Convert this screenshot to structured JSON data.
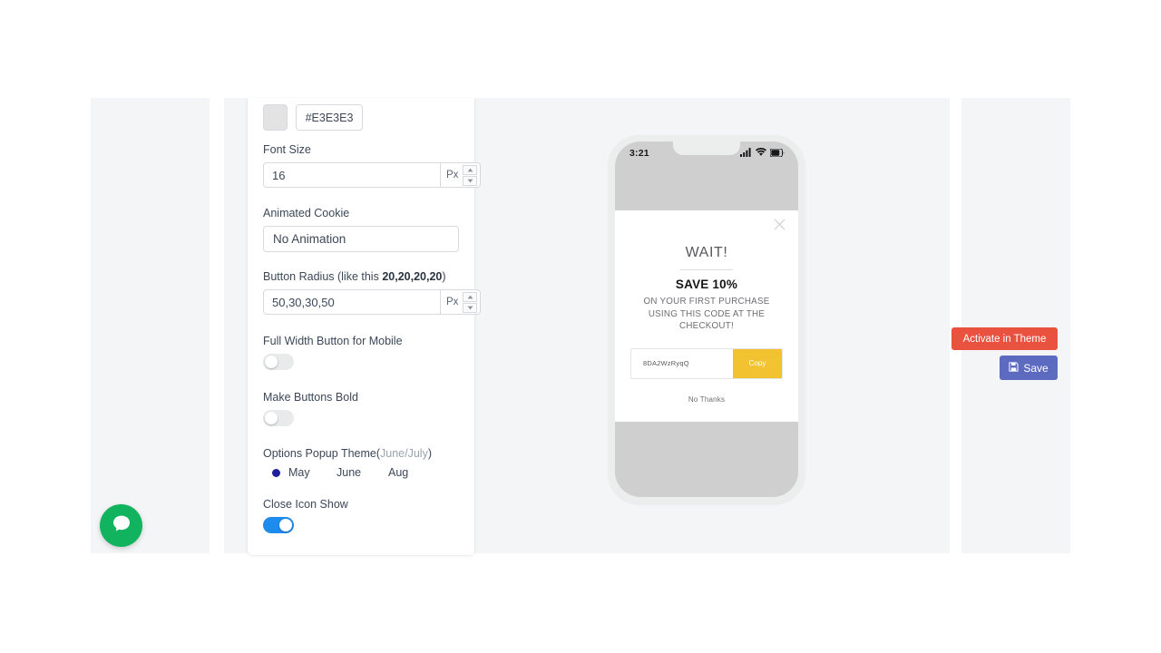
{
  "settings": {
    "color": {
      "swatch_hex": "#E3E3E3",
      "value": "#E3E3E3"
    },
    "font_size": {
      "label": "Font Size",
      "value": "16",
      "unit": "Px"
    },
    "animated_cookie": {
      "label": "Animated Cookie",
      "value": "No Animation"
    },
    "button_radius": {
      "label_prefix": "Button Radius (like this ",
      "label_example": "20,20,20,20",
      "label_suffix": ")",
      "value": "50,30,30,50",
      "unit": "Px"
    },
    "full_width_button": {
      "label": "Full Width Button for Mobile",
      "state": "off"
    },
    "make_buttons_bold": {
      "label": "Make Buttons Bold",
      "state": "off"
    },
    "options_popup_theme": {
      "label_main": "Options Popup Theme(",
      "label_hint_a": "June",
      "label_sep": "/",
      "label_hint_b": "July",
      "label_end": ")",
      "options": [
        {
          "label": "May",
          "selected": true
        },
        {
          "label": "June",
          "selected": false
        },
        {
          "label": "Aug",
          "selected": false
        }
      ]
    },
    "close_icon_show": {
      "label": "Close Icon Show",
      "state": "on"
    }
  },
  "preview": {
    "status_bar": {
      "time": "3:21",
      "signal_icon": "signal-bars-icon",
      "wifi_icon": "wifi-icon",
      "battery_icon": "battery-icon"
    },
    "popup": {
      "close_icon": "close-x-icon",
      "title": "WAIT!",
      "headline": "SAVE 10%",
      "subtext_line1": "ON YOUR FIRST PURCHASE",
      "subtext_line2": "USING THIS CODE AT THE",
      "subtext_line3": "CHECKOUT!",
      "coupon_code": "8DA2WzRyqQ",
      "copy_label": "Copy",
      "decline_label": "No Thanks",
      "copy_button_color": "#f2c230"
    }
  },
  "actions": {
    "activate_label": "Activate in Theme",
    "activate_color": "#e8523f",
    "save_label": "Save",
    "save_color": "#5c6bc0",
    "save_icon": "floppy-disk-icon"
  },
  "chat": {
    "icon": "chat-bubble-icon",
    "color": "#12b35f"
  }
}
